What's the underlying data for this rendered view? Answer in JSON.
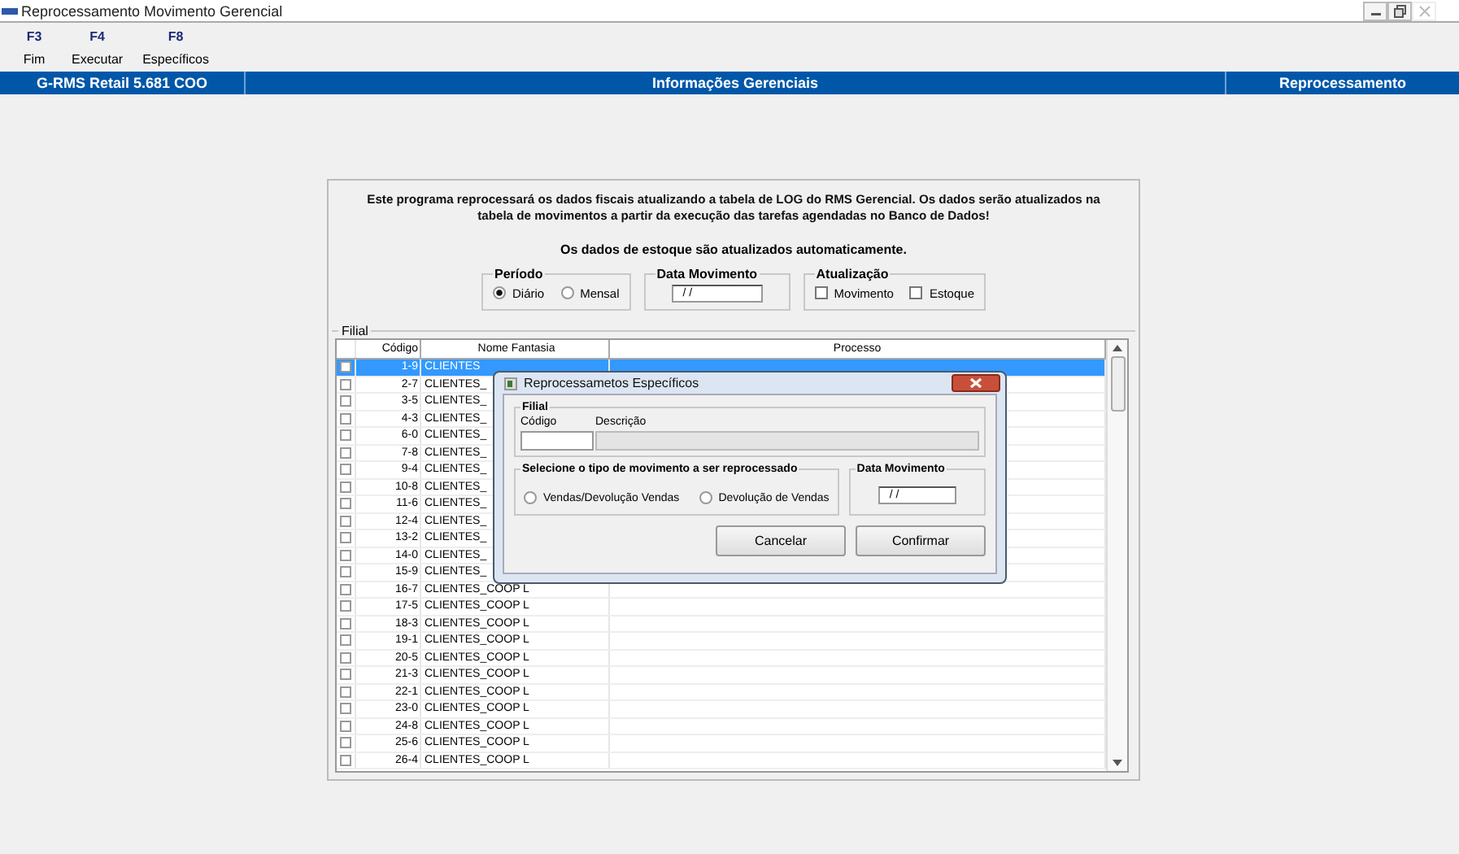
{
  "window": {
    "title": "Reprocessamento Movimento Gerencial"
  },
  "toolbar": [
    {
      "key": "F3",
      "label": "Fim"
    },
    {
      "key": "F4",
      "label": "Executar"
    },
    {
      "key": "F8",
      "label": "Específicos"
    }
  ],
  "header_bar": {
    "product": "G-RMS Retail 5.681 COO",
    "section": "Informações Gerenciais",
    "module": "Reprocessamento"
  },
  "intro": "Este programa reprocessará os dados fiscais atualizando a tabela de LOG do RMS Gerencial. Os dados serão atualizados na tabela de movimentos a partir da execução das tarefas agendadas no Banco de Dados!",
  "note": "Os dados de estoque são atualizados automaticamente.",
  "periodo": {
    "label": "Período",
    "options": [
      {
        "label": "Diário",
        "selected": true
      },
      {
        "label": "Mensal",
        "selected": false
      }
    ]
  },
  "data_movimento": {
    "label": "Data Movimento",
    "value": "/ /"
  },
  "atualizacao": {
    "label": "Atualização",
    "options": [
      {
        "label": "Movimento",
        "checked": false
      },
      {
        "label": "Estoque",
        "checked": false
      }
    ]
  },
  "filial": {
    "label": "Filial",
    "columns": [
      "Código",
      "Nome Fantasia",
      "Processo"
    ],
    "rows": [
      {
        "code": "1-9",
        "name": "CLIENTES",
        "checked": false,
        "selected": true
      },
      {
        "code": "2-7",
        "name": "CLIENTES_",
        "checked": false,
        "selected": false
      },
      {
        "code": "3-5",
        "name": "CLIENTES_",
        "checked": false,
        "selected": false
      },
      {
        "code": "4-3",
        "name": "CLIENTES_",
        "checked": false,
        "selected": false
      },
      {
        "code": "6-0",
        "name": "CLIENTES_",
        "checked": false,
        "selected": false
      },
      {
        "code": "7-8",
        "name": "CLIENTES_",
        "checked": false,
        "selected": false
      },
      {
        "code": "9-4",
        "name": "CLIENTES_",
        "checked": false,
        "selected": false
      },
      {
        "code": "10-8",
        "name": "CLIENTES_",
        "checked": false,
        "selected": false
      },
      {
        "code": "11-6",
        "name": "CLIENTES_",
        "checked": false,
        "selected": false
      },
      {
        "code": "12-4",
        "name": "CLIENTES_",
        "checked": false,
        "selected": false
      },
      {
        "code": "13-2",
        "name": "CLIENTES_",
        "checked": false,
        "selected": false
      },
      {
        "code": "14-0",
        "name": "CLIENTES_",
        "checked": false,
        "selected": false
      },
      {
        "code": "15-9",
        "name": "CLIENTES_",
        "checked": false,
        "selected": false
      },
      {
        "code": "16-7",
        "name": "CLIENTES_COOP L",
        "checked": false,
        "selected": false
      },
      {
        "code": "17-5",
        "name": "CLIENTES_COOP L",
        "checked": false,
        "selected": false
      },
      {
        "code": "18-3",
        "name": "CLIENTES_COOP L",
        "checked": false,
        "selected": false
      },
      {
        "code": "19-1",
        "name": "CLIENTES_COOP L",
        "checked": false,
        "selected": false
      },
      {
        "code": "20-5",
        "name": "CLIENTES_COOP L",
        "checked": false,
        "selected": false
      },
      {
        "code": "21-3",
        "name": "CLIENTES_COOP L",
        "checked": false,
        "selected": false
      },
      {
        "code": "22-1",
        "name": "CLIENTES_COOP L",
        "checked": false,
        "selected": false
      },
      {
        "code": "23-0",
        "name": "CLIENTES_COOP L",
        "checked": false,
        "selected": false
      },
      {
        "code": "24-8",
        "name": "CLIENTES_COOP L",
        "checked": false,
        "selected": false
      },
      {
        "code": "25-6",
        "name": "CLIENTES_COOP L",
        "checked": false,
        "selected": false
      },
      {
        "code": "26-4",
        "name": "CLIENTES_COOP L",
        "checked": false,
        "selected": false
      }
    ]
  },
  "dialog": {
    "title": "Reprocessametos Específicos",
    "filial": {
      "label": "Filial",
      "code_label": "Código",
      "desc_label": "Descrição"
    },
    "tipo": {
      "label": "Selecione o tipo de movimento a ser reprocessado",
      "options": [
        {
          "label": "Vendas/Devolução Vendas",
          "selected": false
        },
        {
          "label": "Devolução de Vendas",
          "selected": false
        }
      ]
    },
    "data_movimento": {
      "label": "Data Movimento",
      "value": "/ /"
    },
    "buttons": [
      "Cancelar",
      "Confirmar"
    ]
  }
}
